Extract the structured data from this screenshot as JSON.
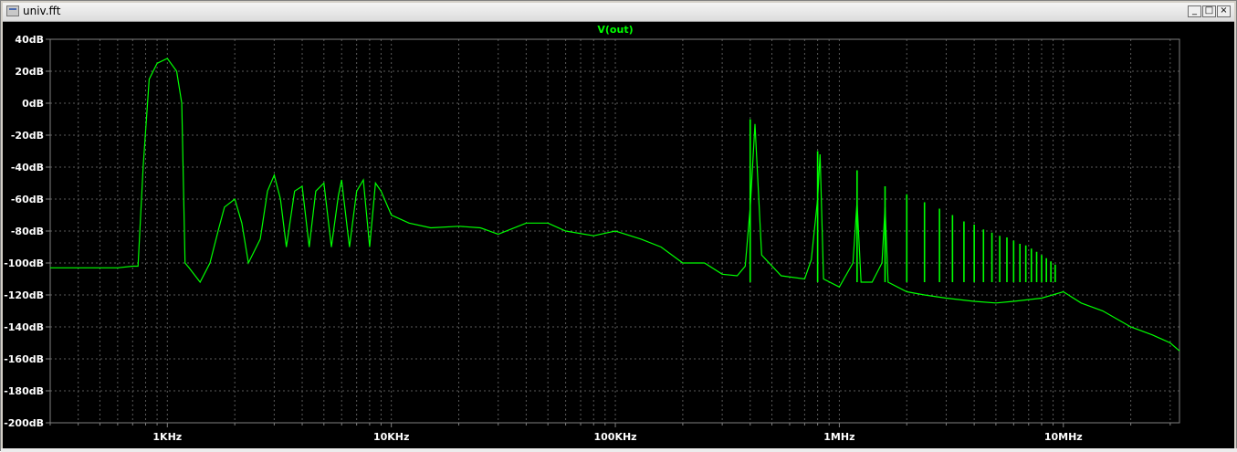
{
  "window": {
    "title": "univ.fft",
    "buttons": {
      "minimize": "_",
      "maximize": "□",
      "close": "×"
    }
  },
  "colors": {
    "trace": "#00ff00",
    "background": "#000000",
    "axis": "#808080",
    "grid": "#5a5a5a",
    "label": "#ffffff"
  },
  "chart_data": {
    "type": "line",
    "title": "V(out)",
    "xscale": "log",
    "xlim": [
      300,
      33000000
    ],
    "ylim": [
      -200,
      40
    ],
    "grid": true,
    "x_ticks": [
      "1KHz",
      "10KHz",
      "100KHz",
      "1MHz",
      "10MHz"
    ],
    "x_tick_values": [
      1000,
      10000,
      100000,
      1000000,
      10000000
    ],
    "y_ticks": [
      "40dB",
      "20dB",
      "0dB",
      "-20dB",
      "-40dB",
      "-60dB",
      "-80dB",
      "-100dB",
      "-120dB",
      "-140dB",
      "-160dB",
      "-180dB",
      "-200dB"
    ],
    "y_tick_values": [
      40,
      20,
      0,
      -20,
      -40,
      -60,
      -80,
      -100,
      -120,
      -140,
      -160,
      -180,
      -200
    ],
    "series": [
      {
        "name": "V(out)",
        "color": "#00ff00",
        "x": [
          300,
          600,
          700,
          740,
          780,
          830,
          900,
          1000,
          1100,
          1160,
          1200,
          1250,
          1400,
          1550,
          1700,
          1800,
          2000,
          2150,
          2300,
          2600,
          2800,
          3000,
          3200,
          3400,
          3700,
          4000,
          4300,
          4600,
          5000,
          5400,
          5800,
          6000,
          6500,
          7000,
          7500,
          8000,
          8500,
          9000,
          10000,
          12000,
          15000,
          20000,
          25000,
          30000,
          40000,
          50000,
          60000,
          80000,
          100000,
          130000,
          160000,
          200000,
          250000,
          300000,
          350000,
          380000,
          400000,
          420000,
          450000,
          550000,
          700000,
          750000,
          800000,
          820000,
          850000,
          1000000,
          1150000,
          1200000,
          1250000,
          1400000,
          1550000,
          1600000,
          1650000,
          2000000,
          2400000,
          3000000,
          4000000,
          5000000,
          6000000,
          8000000,
          10000000,
          12000000,
          15000000,
          20000000,
          25000000,
          30000000,
          33000000
        ],
        "values": [
          -103,
          -103,
          -102,
          -102,
          -40,
          15,
          25,
          28,
          20,
          0,
          -100,
          -103,
          -112,
          -100,
          -78,
          -65,
          -60,
          -75,
          -100,
          -85,
          -55,
          -45,
          -60,
          -90,
          -55,
          -52,
          -90,
          -55,
          -50,
          -90,
          -58,
          -48,
          -90,
          -55,
          -48,
          -90,
          -50,
          -55,
          -70,
          -75,
          -78,
          -77,
          -78,
          -82,
          -75,
          -75,
          -80,
          -83,
          -80,
          -85,
          -90,
          -100,
          -100,
          -107,
          -108,
          -102,
          -65,
          -13,
          -95,
          -108,
          -110,
          -98,
          -60,
          -32,
          -110,
          -115,
          -100,
          -62,
          -112,
          -112,
          -100,
          -65,
          -112,
          -118,
          -120,
          -122,
          -124,
          -125,
          -124,
          -122,
          -118,
          -125,
          -130,
          -140,
          -145,
          -150,
          -155
        ]
      }
    ],
    "harmonic_spikes": [
      {
        "x": 400000,
        "value": -10
      },
      {
        "x": 800000,
        "value": -30
      },
      {
        "x": 1200000,
        "value": -42
      },
      {
        "x": 1600000,
        "value": -52
      },
      {
        "x": 2000000,
        "value": -57
      },
      {
        "x": 2400000,
        "value": -62
      },
      {
        "x": 2800000,
        "value": -66
      },
      {
        "x": 3200000,
        "value": -70
      },
      {
        "x": 3600000,
        "value": -74
      },
      {
        "x": 4000000,
        "value": -76
      },
      {
        "x": 4400000,
        "value": -79
      },
      {
        "x": 4800000,
        "value": -81
      },
      {
        "x": 5200000,
        "value": -83
      },
      {
        "x": 5600000,
        "value": -84
      },
      {
        "x": 6000000,
        "value": -86
      },
      {
        "x": 6400000,
        "value": -88
      },
      {
        "x": 6800000,
        "value": -89
      },
      {
        "x": 7200000,
        "value": -91
      },
      {
        "x": 7600000,
        "value": -93
      },
      {
        "x": 8000000,
        "value": -95
      },
      {
        "x": 8400000,
        "value": -97
      },
      {
        "x": 8800000,
        "value": -99
      },
      {
        "x": 9200000,
        "value": -101
      }
    ]
  }
}
